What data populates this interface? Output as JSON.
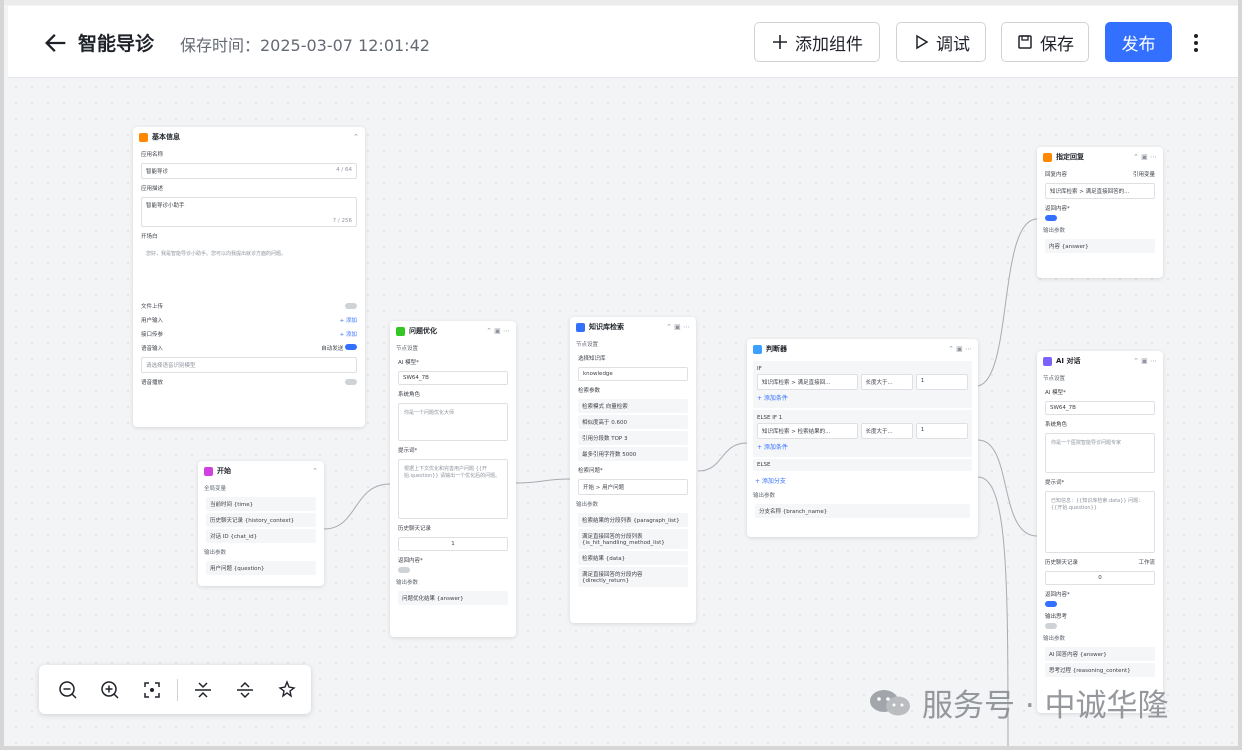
{
  "header": {
    "title": "智能导诊",
    "save_time": "保存时间：2025-03-07 12:01:42",
    "buttons": {
      "add": "添加组件",
      "debug": "调试",
      "save": "保存",
      "publish": "发布"
    }
  },
  "colors": {
    "primary": "#3370ff",
    "canvas": "#f3f4f6"
  },
  "nodes": {
    "basic": {
      "title": "基本信息",
      "app_name_label": "应用名称",
      "app_name": "智能导诊",
      "app_name_count": "4 / 64",
      "desc_label": "应用描述",
      "desc": "智能导诊小助手",
      "desc_count": "7 / 256",
      "opening_label": "开场白",
      "opening": "您好，我是智能导诊小助手。您可以向我提出就诊方面的问题。",
      "file_upload": "文件上传",
      "user_input": "用户输入",
      "interface_param": "接口传参",
      "add": "+ 添加",
      "voice_input": "语音输入",
      "auto_send": "自动发送",
      "voice_placeholder": "请选择语音识别模型",
      "voice_play": "语音播放"
    },
    "start": {
      "title": "开始",
      "global_vars": "全局变量",
      "vars": [
        "当前时间 {time}",
        "历史聊天记录 {history_context}",
        "对话 ID {chat_id}"
      ],
      "output_label": "输出参数",
      "output": "用户问题 {question}"
    },
    "optimize": {
      "title": "问题优化",
      "settings": "节点设置",
      "model_label": "AI 模型*",
      "model": "SW64_7B",
      "role_label": "系统角色",
      "role": "你是一个问题优化大师",
      "prompt_label": "提示词*",
      "prompt": "根据上下文优化和完善用户问题 {{开始.question}} 请输出一个优化后的问题。",
      "history_label": "历史聊天记录",
      "history": "1",
      "return_label": "返回内容*",
      "output_label": "输出参数",
      "output": "问题优化结果 {answer}"
    },
    "kb": {
      "title": "知识库检索",
      "settings": "节点设置",
      "select_kb": "选择知识库",
      "kb_name": "knowledge",
      "params_label": "检索参数",
      "params": [
        {
          "k": "检索模式",
          "v": "向量检索"
        },
        {
          "k": "相似度高于",
          "v": "0.600"
        },
        {
          "k": "引用分段数 TOP",
          "v": "3"
        },
        {
          "k": "最多引用字符数",
          "v": "5000"
        }
      ],
      "question_label": "检索问题*",
      "question": "开始 > 用户问题",
      "output_label": "输出参数",
      "outputs": [
        "检索结果的分段列表 {paragraph_list}",
        "满足直接回答的分段列表 {is_hit_handling_method_list}",
        "检索结果 {data}",
        "满足直接回答的分段内容 {directly_return}"
      ]
    },
    "judge": {
      "title": "判断器",
      "if": "IF",
      "cond1": "知识库检索 > 满足直接回...",
      "op1": "长度大于...",
      "val1": "1",
      "add_cond": "+ 添加条件",
      "elseif": "ELSE IF 1",
      "cond2": "知识库检索 > 检索结果的...",
      "op2": "长度大于...",
      "val2": "1",
      "else": "ELSE",
      "add_branch": "+ 添加分支",
      "output_label": "输出参数",
      "output": "分支名称 {branch_name}"
    },
    "reply": {
      "title": "指定回复",
      "content_label": "回复内容",
      "ref": "引用变量",
      "content": "知识库检索 > 满足直接回答的...",
      "return_label": "返回内容*",
      "output_label": "输出参数",
      "output": "内容 {answer}"
    },
    "ai": {
      "title": "AI 对话",
      "settings": "节点设置",
      "model_label": "AI 模型*",
      "model": "SW64_7B",
      "role_label": "系统角色",
      "role": "你是一个医院智能导诊问题专家",
      "prompt_label": "提示词*",
      "prompt": "已知信息：{{知识库检索.data}} 问题：{{开始.question}}",
      "history_label": "历史聊天记录",
      "history_mode": "工作流",
      "history": "0",
      "return_label": "返回内容*",
      "think_label": "输出思考",
      "output_label": "输出参数",
      "outputs": [
        "AI 回答内容 {answer}",
        "思考过程 {reasoning_content}"
      ]
    }
  },
  "watermark": "服务号 · 中诚华隆"
}
